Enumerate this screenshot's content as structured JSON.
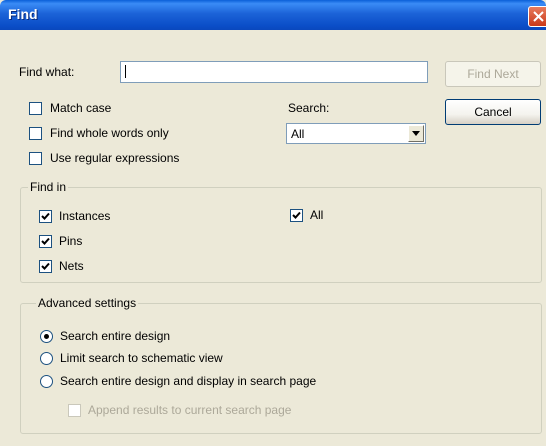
{
  "window": {
    "title": "Find"
  },
  "find_what": {
    "label": "Find what:",
    "value": ""
  },
  "buttons": {
    "find_next": "Find Next",
    "cancel": "Cancel"
  },
  "options": {
    "match_case": {
      "label": "Match case",
      "checked": false
    },
    "whole_words": {
      "label": "Find whole words only",
      "checked": false
    },
    "regex": {
      "label": "Use regular expressions",
      "checked": false
    }
  },
  "search": {
    "label": "Search:",
    "selected": "All"
  },
  "find_in": {
    "legend": "Find in",
    "instances": {
      "label": "Instances",
      "checked": true
    },
    "pins": {
      "label": "Pins",
      "checked": true
    },
    "nets": {
      "label": "Nets",
      "checked": true
    },
    "all": {
      "label": "All",
      "checked": true
    }
  },
  "advanced": {
    "legend": "Advanced settings",
    "entire_design": {
      "label": "Search entire design",
      "selected": true
    },
    "schematic_view": {
      "label": "Limit search to schematic view",
      "selected": false
    },
    "search_page": {
      "label": "Search entire design and display in search page",
      "selected": false
    },
    "append_results": {
      "label": "Append results to current search page",
      "checked": false,
      "enabled": false
    }
  },
  "icons": {
    "close": "close-icon",
    "check": "checkmark-icon",
    "dropdown": "chevron-down-icon"
  }
}
